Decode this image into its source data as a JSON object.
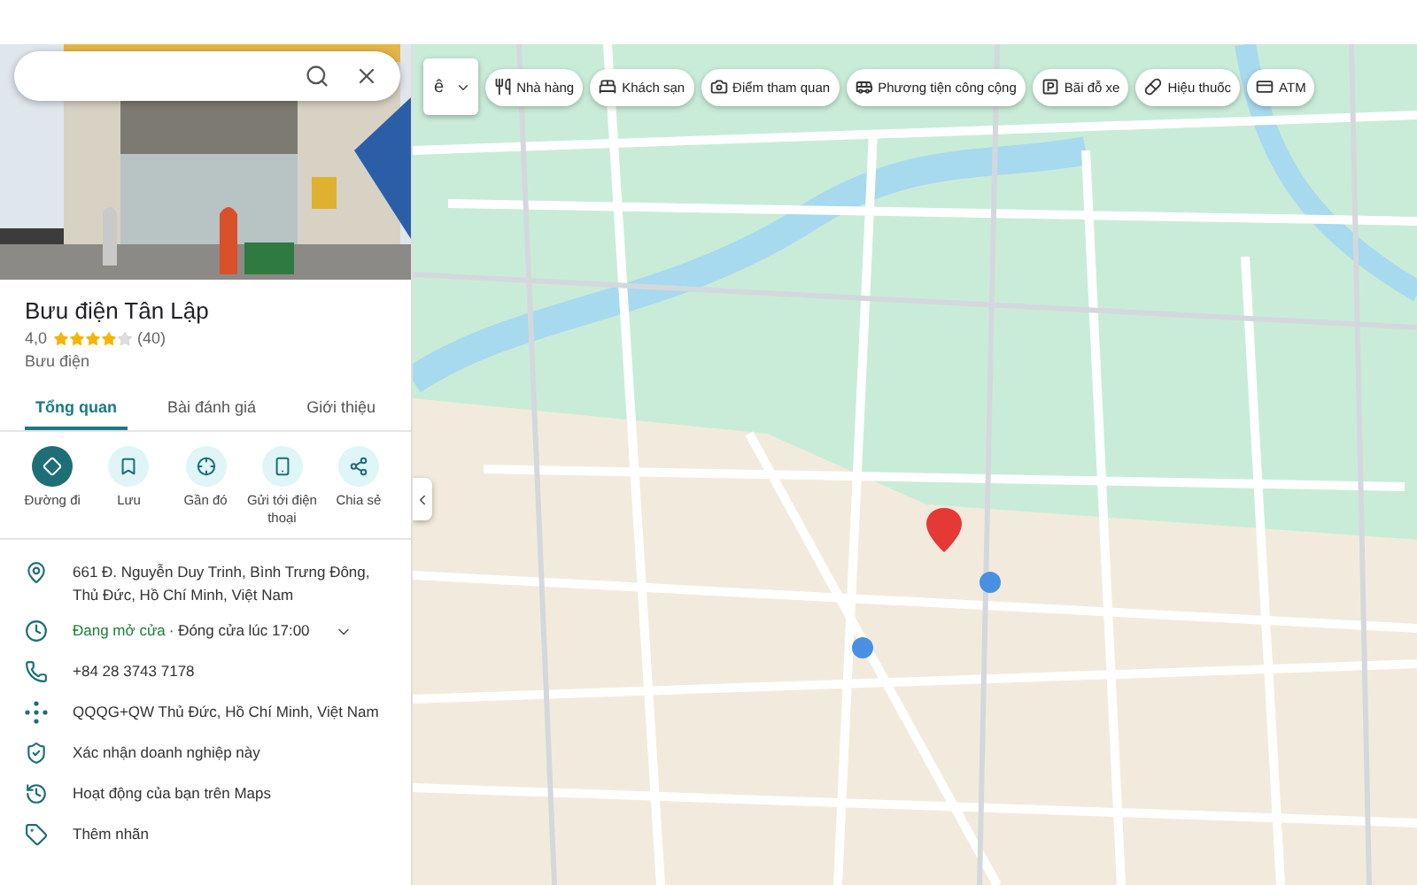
{
  "place": {
    "title": "Bưu điện Tân Lập",
    "rating": "4,0",
    "stars": 4,
    "review_count": "(40)",
    "category": "Bưu điện"
  },
  "tabs": [
    {
      "label": "Tổng quan",
      "selected": true
    },
    {
      "label": "Bài đánh giá",
      "selected": false
    },
    {
      "label": "Giới thiệu",
      "selected": false
    }
  ],
  "actions": [
    {
      "kind": "directions",
      "label": "Đường đi",
      "primary": true
    },
    {
      "kind": "save",
      "label": "Lưu",
      "primary": false
    },
    {
      "kind": "nearby",
      "label": "Gần đó",
      "primary": false
    },
    {
      "kind": "phone",
      "label": "Gửi tới điện thoại",
      "primary": false
    },
    {
      "kind": "share",
      "label": "Chia sẻ",
      "primary": false
    }
  ],
  "info": [
    {
      "kind": "address",
      "text": "661 Đ. Nguyễn Duy Trinh, Bình Trưng Đông, Thủ Đức, Hồ Chí Minh, Việt Nam"
    },
    {
      "kind": "hours",
      "status": "Đang mở cửa",
      "text": "· Đóng cửa lúc 17:00"
    },
    {
      "kind": "phone",
      "text": "+84 28 3743 7178"
    },
    {
      "kind": "plus_code",
      "text": "QQQG+QW Thủ Đức, Hồ Chí Minh, Việt Nam"
    },
    {
      "kind": "claim",
      "text": "Xác nhận doanh nghiệp này"
    },
    {
      "kind": "activity",
      "text": "Hoạt động của bạn trên Maps"
    },
    {
      "kind": "label",
      "text": "Thêm nhãn"
    }
  ],
  "input_tool": {
    "label": "ê"
  },
  "chips": [
    {
      "kind": "restaurant",
      "label": "Nhà hàng"
    },
    {
      "kind": "hotel",
      "label": "Khách sạn"
    },
    {
      "kind": "attraction",
      "label": "Điểm tham quan"
    },
    {
      "kind": "transit",
      "label": "Phương tiện công cộng"
    },
    {
      "kind": "parking",
      "label": "Bãi đỗ xe"
    },
    {
      "kind": "pharmacy",
      "label": "Hiệu thuốc"
    },
    {
      "kind": "atm",
      "label": "ATM"
    }
  ]
}
